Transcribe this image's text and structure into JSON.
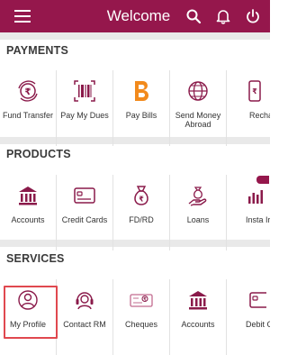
{
  "header": {
    "title": "Welcome"
  },
  "sections": [
    {
      "title": "PAYMENTS",
      "items": [
        {
          "label": "Fund Transfer",
          "icon": "rupee-transfer-icon"
        },
        {
          "label": "Pay My Dues",
          "icon": "barcode-icon"
        },
        {
          "label": "Pay Bills",
          "icon": "bharat-billpay-icon"
        },
        {
          "label": "Send Money Abroad",
          "icon": "globe-money-icon"
        },
        {
          "label": "Recha",
          "icon": "mobile-recharge-icon"
        }
      ]
    },
    {
      "title": "PRODUCTS",
      "items": [
        {
          "label": "Accounts",
          "icon": "bank-icon"
        },
        {
          "label": "Credit Cards",
          "icon": "credit-card-icon"
        },
        {
          "label": "FD/RD",
          "icon": "money-bag-icon"
        },
        {
          "label": "Loans",
          "icon": "loan-hand-icon"
        },
        {
          "label": "Insta Ir",
          "icon": "insta-chart-icon"
        }
      ]
    },
    {
      "title": "SERVICES",
      "items": [
        {
          "label": "My Profile",
          "icon": "profile-icon"
        },
        {
          "label": "Contact RM",
          "icon": "headset-icon"
        },
        {
          "label": "Cheques",
          "icon": "cheque-icon"
        },
        {
          "label": "Accounts",
          "icon": "bank-icon"
        },
        {
          "label": "Debit C",
          "icon": "debit-card-icon"
        }
      ]
    }
  ],
  "colors": {
    "brand": "#95174c",
    "icon": "#8a1a4a",
    "billpay": "#f28a1c",
    "highlight": "#e0484f"
  }
}
